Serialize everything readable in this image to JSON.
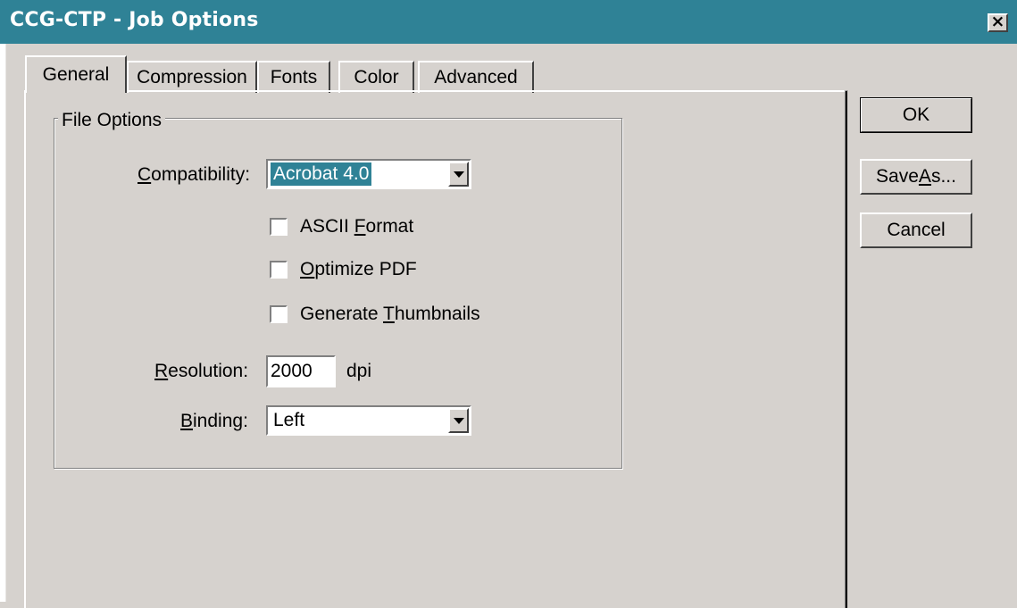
{
  "window": {
    "title": "CCG-CTP - Job Options",
    "close_glyph": "×"
  },
  "tabs": [
    {
      "label": "General",
      "active": true
    },
    {
      "label": "Compression",
      "active": false
    },
    {
      "label": "Fonts",
      "active": false
    },
    {
      "label": "Color",
      "active": false
    },
    {
      "label": "Advanced",
      "active": false
    }
  ],
  "file_options": {
    "legend": "File Options",
    "compatibility": {
      "label_pre": "",
      "label_u": "C",
      "label_post": "ompatibility:",
      "value": "Acrobat 4.0"
    },
    "ascii_format": {
      "label_pre": "ASCII ",
      "label_u": "F",
      "label_post": "ormat",
      "checked": false
    },
    "optimize_pdf": {
      "label_pre": "",
      "label_u": "O",
      "label_post": "ptimize PDF",
      "checked": false
    },
    "generate_thumbnails": {
      "label_pre": "Generate ",
      "label_u": "T",
      "label_post": "humbnails",
      "checked": false
    },
    "resolution": {
      "label_pre": "",
      "label_u": "R",
      "label_post": "esolution:",
      "value": "2000",
      "unit": "dpi"
    },
    "binding": {
      "label_pre": "",
      "label_u": "B",
      "label_post": "inding:",
      "value": "Left"
    }
  },
  "buttons": {
    "ok": "OK",
    "save_as_pre": "Save ",
    "save_as_u": "A",
    "save_as_post": "s...",
    "cancel": "Cancel"
  },
  "colors": {
    "titlebar": "#2f8296",
    "dialog_face": "#d6d2ce",
    "selection": "#2f8296"
  }
}
